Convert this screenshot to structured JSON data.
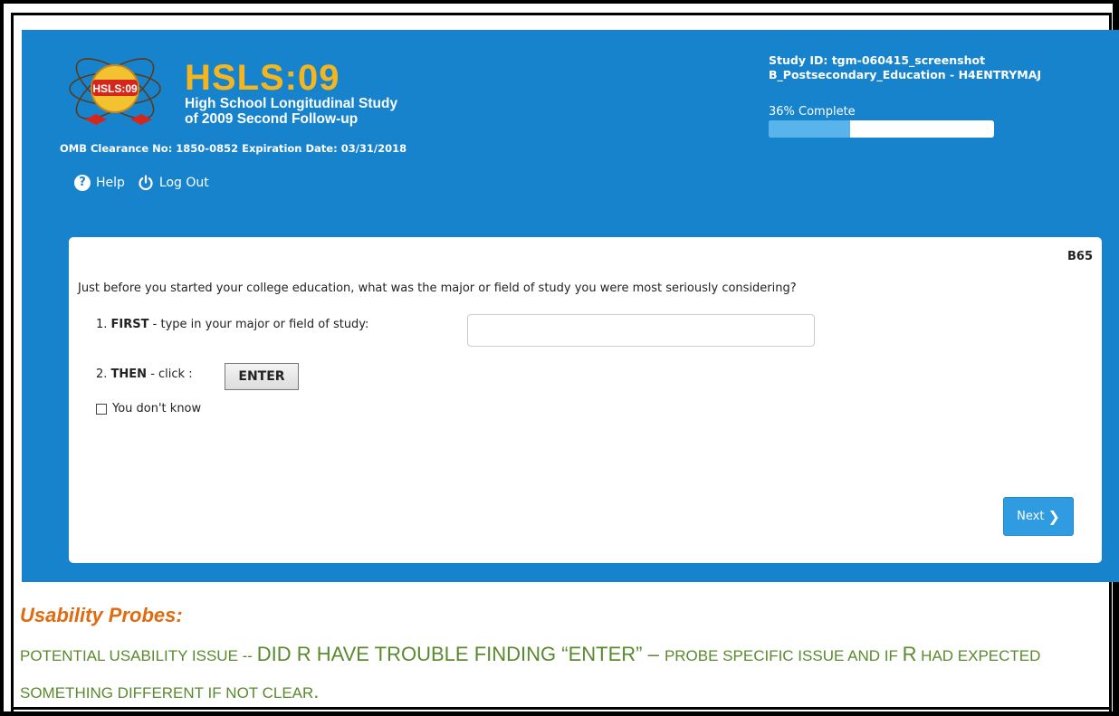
{
  "header": {
    "logo_text": "HSLS:09",
    "brand_name": "HSLS:09",
    "brand_line1": "High School Longitudinal Study",
    "brand_line2": "of 2009 Second Follow-up",
    "omb": "OMB Clearance No: 1850-0852 Expiration Date: 03/31/2018",
    "study_id": "Study ID: tgm-060415_screenshot",
    "section": "B_Postsecondary_Education - H4ENTRYMAJ",
    "progress_label": "36% Complete",
    "progress_value": 0.36
  },
  "nav": {
    "help": "Help",
    "logout": "Log Out"
  },
  "question": {
    "id": "B65",
    "text": "Just before you started your college education, what was the major or field of study you were most seriously considering?",
    "step1_num": "1.",
    "step1_bold": "FIRST",
    "step1_rest": "- type in your major or field of study:",
    "input_value": "",
    "step2_num": "2.",
    "step2_bold": "THEN",
    "step2_rest": "- click :",
    "enter_label": "ENTER",
    "dont_know_label": "You don't know",
    "next_label": "Next"
  },
  "probes": {
    "title": "Usability Probes:",
    "part1": "POTENTIAL USABILITY ISSUE -- ",
    "part2": "DID R HAVE TROUBLE FINDING “ENTER”",
    "part3": " – ",
    "part4": "PROBE SPECIFIC ISSUE AND IF ",
    "part5": "R",
    "part6": " HAD EXPECTED SOMETHING DIFFERENT IF NOT CLEAR",
    "part7": "."
  },
  "colors": {
    "header_bg": "#1683cc",
    "brand_orange": "#f5b51e",
    "probe_title": "#e06b10",
    "probe_text": "#5a8a2e"
  }
}
